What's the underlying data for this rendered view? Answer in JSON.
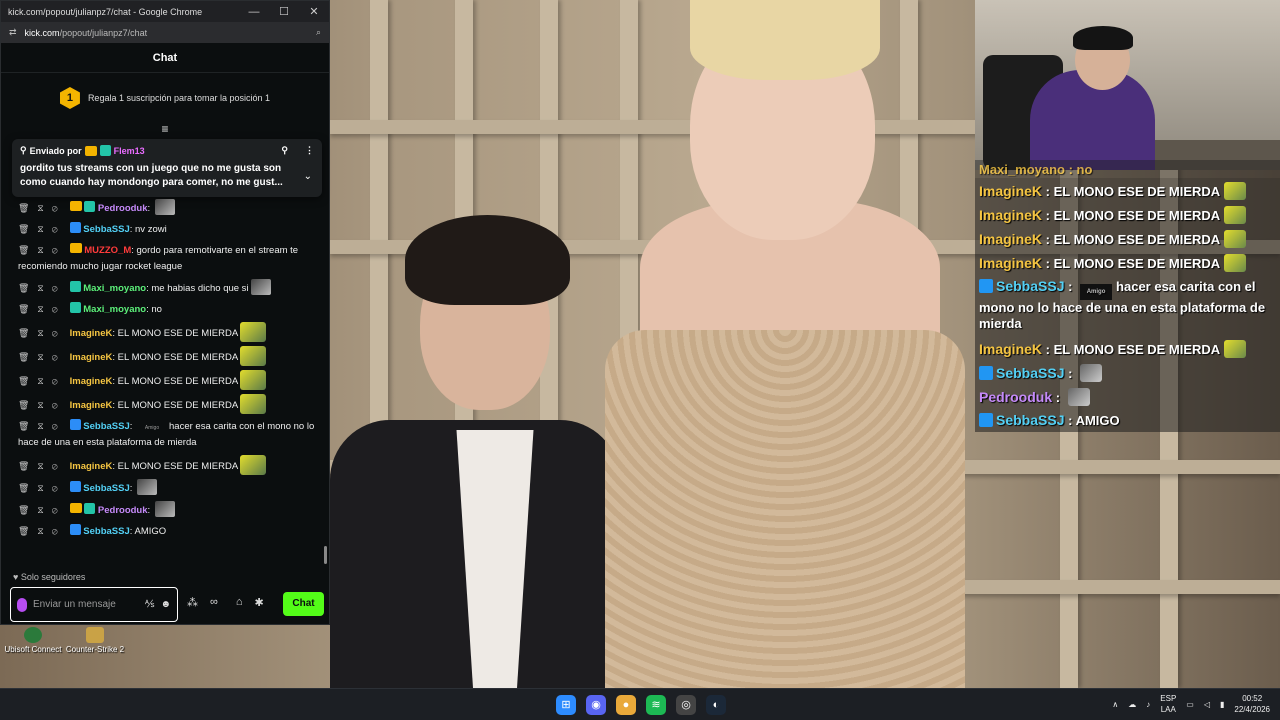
{
  "window": {
    "title": "kick.com/popout/julianpz7/chat - Google Chrome",
    "url_host": "kick.com",
    "url_path": "/popout/julianpz7/chat"
  },
  "chat": {
    "header": "Chat",
    "sub_goal_rank": "1",
    "sub_goal_text": "Regala 1 suscripción para tomar la posición 1",
    "pinned": {
      "sent_by": "Enviado por",
      "user": "Flem13",
      "text": "gordito tus streams con un juego que no me gusta son como cuando hay mondongo para comer, no me gust..."
    },
    "messages": [
      {
        "user": "Pedrooduk",
        "color": "#c58af9",
        "text": "",
        "crown": true,
        "badge": "green",
        "thumb": true
      },
      {
        "user": "SebbaSSJ",
        "color": "#53d0f5",
        "text": "nv zowi",
        "badge": "blue"
      },
      {
        "user": "MUZZO_M",
        "color": "#ff3b3b",
        "text": "gordo para remotivarte en el stream te recomiendo mucho jugar rocket league",
        "crown": true
      },
      {
        "user": "Maxi_moyano",
        "color": "#5cf07a",
        "text": "me habias dicho que si",
        "badge": "green",
        "thumb": true
      },
      {
        "user": "Maxi_moyano",
        "color": "#5cf07a",
        "text": "no",
        "badge": "green"
      },
      {
        "user": "ImagineK",
        "color": "#f5c542",
        "text": "EL MONO ESE DE MIERDA",
        "emote": true
      },
      {
        "user": "ImagineK",
        "color": "#f5c542",
        "text": "EL MONO ESE DE MIERDA",
        "emote": true
      },
      {
        "user": "ImagineK",
        "color": "#f5c542",
        "text": "EL MONO ESE DE MIERDA",
        "emote": true
      },
      {
        "user": "ImagineK",
        "color": "#f5c542",
        "text": "EL MONO ESE DE MIERDA",
        "emote": true
      },
      {
        "user": "SebbaSSJ",
        "color": "#53d0f5",
        "text": "hacer esa carita con el mono no lo hace de una en esta plataforma de mierda",
        "badge": "blue",
        "amigo": "Amigo"
      },
      {
        "user": "ImagineK",
        "color": "#f5c542",
        "text": "EL MONO ESE DE MIERDA",
        "emote": true
      },
      {
        "user": "SebbaSSJ",
        "color": "#53d0f5",
        "text": "",
        "badge": "blue",
        "thumb": true
      },
      {
        "user": "Pedrooduk",
        "color": "#c58af9",
        "text": "",
        "crown": true,
        "badge": "green",
        "thumb": true
      },
      {
        "user": "SebbaSSJ",
        "color": "#53d0f5",
        "text": "AMIGO",
        "badge": "blue"
      }
    ],
    "followers_only": "Solo seguidores",
    "composer_placeholder": "Enviar un mensaje",
    "send_button": "Chat"
  },
  "overlay": {
    "partial_top": "Maxi_moyano : no",
    "rows": [
      {
        "user": "ImagineK",
        "color": "#f5c542",
        "text": "EL MONO ESE DE MIERDA",
        "emote": true
      },
      {
        "user": "ImagineK",
        "color": "#f5c542",
        "text": "EL MONO ESE DE MIERDA",
        "emote": true
      },
      {
        "user": "ImagineK",
        "color": "#f5c542",
        "text": "EL MONO ESE DE MIERDA",
        "emote": true
      },
      {
        "user": "ImagineK",
        "color": "#f5c542",
        "text": "EL MONO ESE DE MIERDA",
        "emote": true
      },
      {
        "user": "SebbaSSJ",
        "color": "#53d0f5",
        "text": "hacer esa carita con el mono no lo hace de una en esta plataforma de mierda",
        "badge": true,
        "amigo": "Amigo"
      },
      {
        "user": "ImagineK",
        "color": "#f5c542",
        "text": "EL MONO ESE DE MIERDA",
        "emote": true
      },
      {
        "user": "SebbaSSJ",
        "color": "#53d0f5",
        "text": "",
        "badge": true,
        "gray": true
      },
      {
        "user": "Pedrooduk",
        "color": "#c58af9",
        "text": "",
        "gray": true
      },
      {
        "user": "SebbaSSJ",
        "color": "#53d0f5",
        "text": "AMIGO",
        "badge": true
      }
    ]
  },
  "desktop": {
    "icons": [
      {
        "label": "Ubisoft Connect",
        "icon": "ubisoft-icon"
      },
      {
        "label": "Counter-Strike 2",
        "icon": "cs2-icon"
      }
    ]
  },
  "taskbar": {
    "apps": [
      {
        "name": "windows-start-icon",
        "glyph": "⊞",
        "color": "#2d8cff"
      },
      {
        "name": "discord-icon",
        "glyph": "◉",
        "color": "#5865f2"
      },
      {
        "name": "chrome-icon",
        "glyph": "●",
        "color": "#e9a93a"
      },
      {
        "name": "spotify-icon",
        "glyph": "≋",
        "color": "#1db954"
      },
      {
        "name": "obs-icon",
        "glyph": "◎",
        "color": "#444444"
      },
      {
        "name": "steam-icon",
        "glyph": "◐",
        "color": "#1b2838"
      }
    ],
    "lang_top": "ESP",
    "lang_bottom": "LAA",
    "time": "00:52",
    "date": "22/4/2026"
  }
}
